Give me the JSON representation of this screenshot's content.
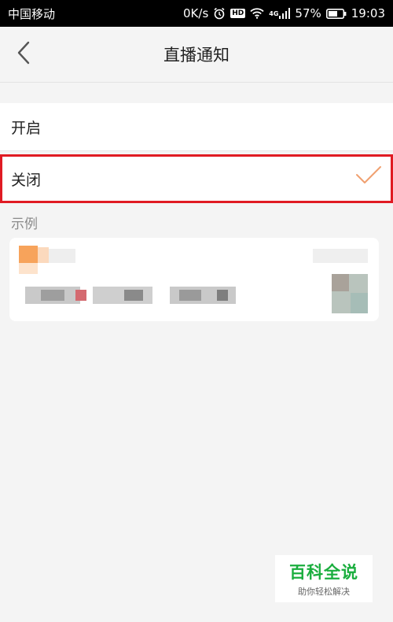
{
  "status_bar": {
    "carrier": "中国移动",
    "speed": "0K/s",
    "hd": "HD",
    "network": "4G",
    "battery": "57%",
    "time": "19:03"
  },
  "header": {
    "title": "直播通知",
    "back_icon": "chevron-left-icon"
  },
  "options": [
    {
      "label": "开启",
      "selected": false
    },
    {
      "label": "关闭",
      "selected": true
    }
  ],
  "example": {
    "label": "示例"
  },
  "watermark": {
    "main": "百科全说",
    "sub": "助你轻松解决"
  },
  "colors": {
    "selection_outline": "#e01b23",
    "check": "#f0a070",
    "watermark_green": "#1aae3e"
  }
}
